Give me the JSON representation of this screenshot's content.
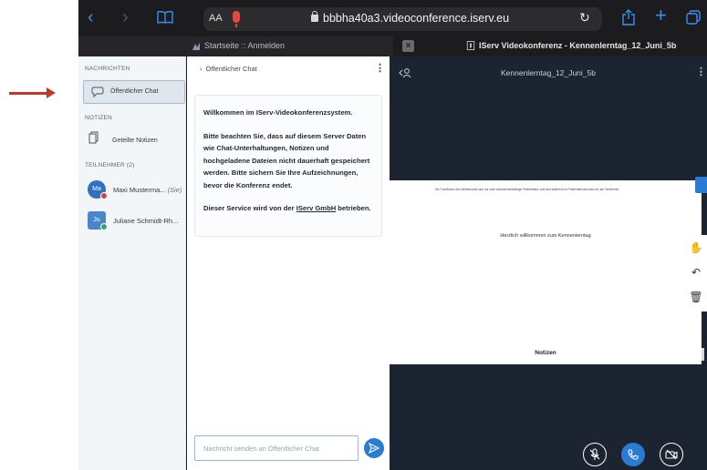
{
  "browser": {
    "text_size_label": "AA",
    "url": "bbbha40a3.videoconference.iserv.eu"
  },
  "tabs": [
    {
      "label": "Startseite :: Anmelden",
      "active": false
    },
    {
      "label": "IServ Videokonferenz - Kennenlerntag_12_Juni_5b",
      "active": true
    }
  ],
  "sidebar": {
    "messages_heading": "NACHRICHTEN",
    "public_chat_label": "Öffentlicher Chat",
    "notes_heading": "NOTIZEN",
    "shared_notes_label": "Geteilte Notizen",
    "participants_heading": "TEILNEHMER (2)",
    "participants": [
      {
        "initials": "Ma",
        "name": "Maxi Musterma...",
        "suffix": "(Sie)",
        "status_color": "#e0393e"
      },
      {
        "initials": "Ju",
        "name": "Juliane Schmidt-Rh...",
        "suffix": "",
        "status_color": "#3aa65b"
      }
    ]
  },
  "chat": {
    "header": "Öffentlicher Chat",
    "welcome": "Willkommen im IServ-Videokonferenzsystem.",
    "notice": "Bitte beachten Sie, dass auf diesem Server Daten wie Chat-Unterhaltungen, Notizen und hochgeladene Dateien nicht dauerhaft gespeichert werden. Bitte sichern Sie Ihre Aufzeichnungen, bevor die Konferenz endet.",
    "service_prefix": "Dieser Service wird von der ",
    "service_link": "IServ GmbH",
    "service_suffix": " betrieben.",
    "input_placeholder": "Nachricht senden an Öffentlicher Chat"
  },
  "presentation": {
    "title": "Kennenlerntag_12_Juni_5b",
    "slide_small_text": "Die Funktionen des Whiteboards sind nur nicht anwesenheitsfähige Präsentation und sind weiterhin im Präsentationsmodus für alle Teilnehmer",
    "slide_welcome": "Herzlich willkommen zum Kennenlerntag",
    "slide_notes": "Notizen"
  },
  "colors": {
    "accent": "#2a7bd4",
    "annotation_arrow": "#c0392b"
  }
}
